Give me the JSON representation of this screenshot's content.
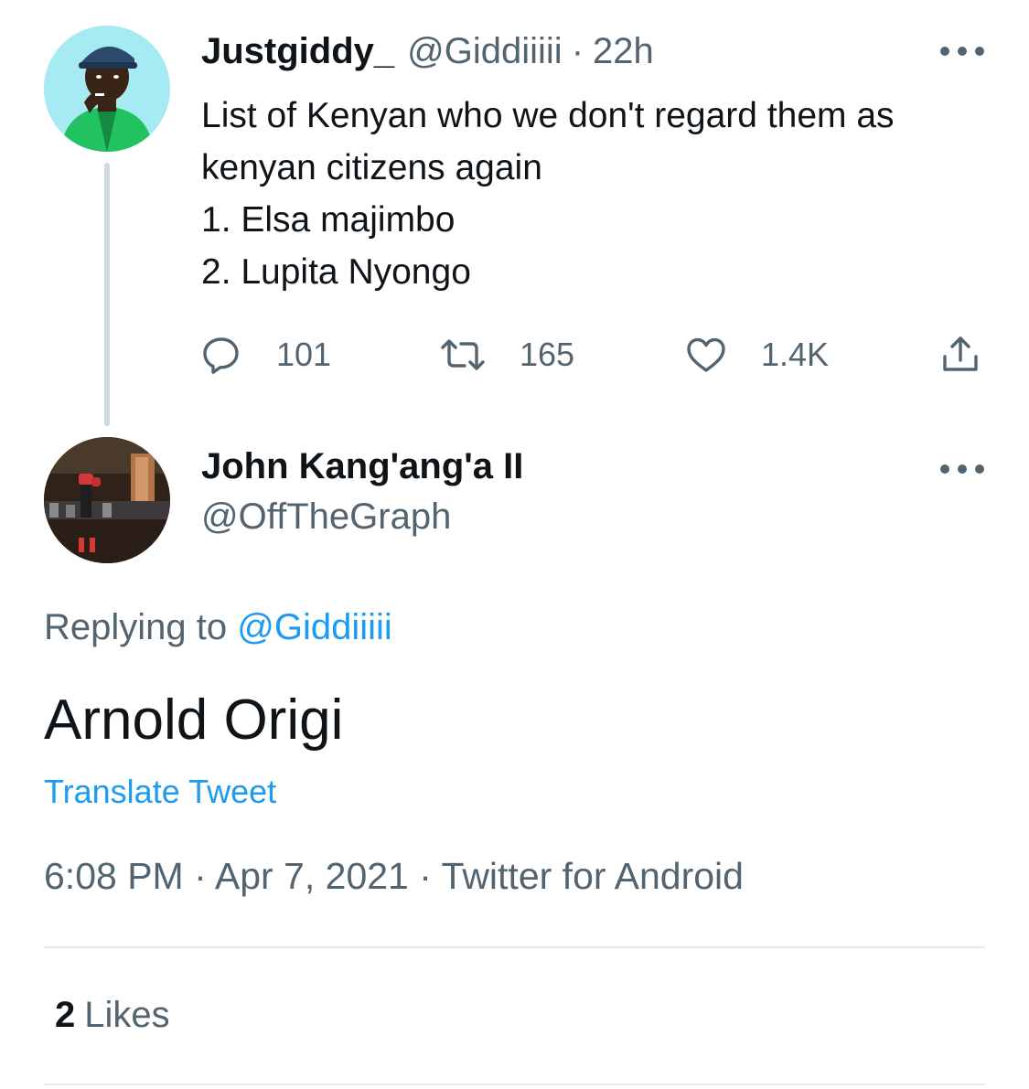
{
  "parent_tweet": {
    "display_name": "Justgiddy_",
    "handle": "@Giddiiiii",
    "separator": "·",
    "time": "22h",
    "lines": [
      "List of Kenyan who we don't regard them as",
      "kenyan citizens again",
      "1. Elsa majimbo",
      "2. Lupita Nyongo"
    ],
    "reply_count": "101",
    "retweet_count": "165",
    "like_count": "1.4K",
    "icons": [
      "reply-icon",
      "retweet-icon",
      "like-icon",
      "share-icon",
      "more-icon"
    ]
  },
  "reply_tweet": {
    "display_name": "John Kang'ang'a II",
    "handle": "@OffTheGraph",
    "replying_prefix": "Replying to",
    "replying_mention": "@Giddiiiii",
    "text": "Arnold Origi",
    "translate_label": "Translate Tweet",
    "meta": "6:08 PM · Apr 7, 2021 · Twitter for Android",
    "likes_count": "2",
    "likes_label": "Likes"
  },
  "colors": {
    "text": "#0f1419",
    "secondary": "#536471",
    "link": "#1d9bf0",
    "divider": "#e7e9eb",
    "thread_line": "#cfd9de"
  }
}
